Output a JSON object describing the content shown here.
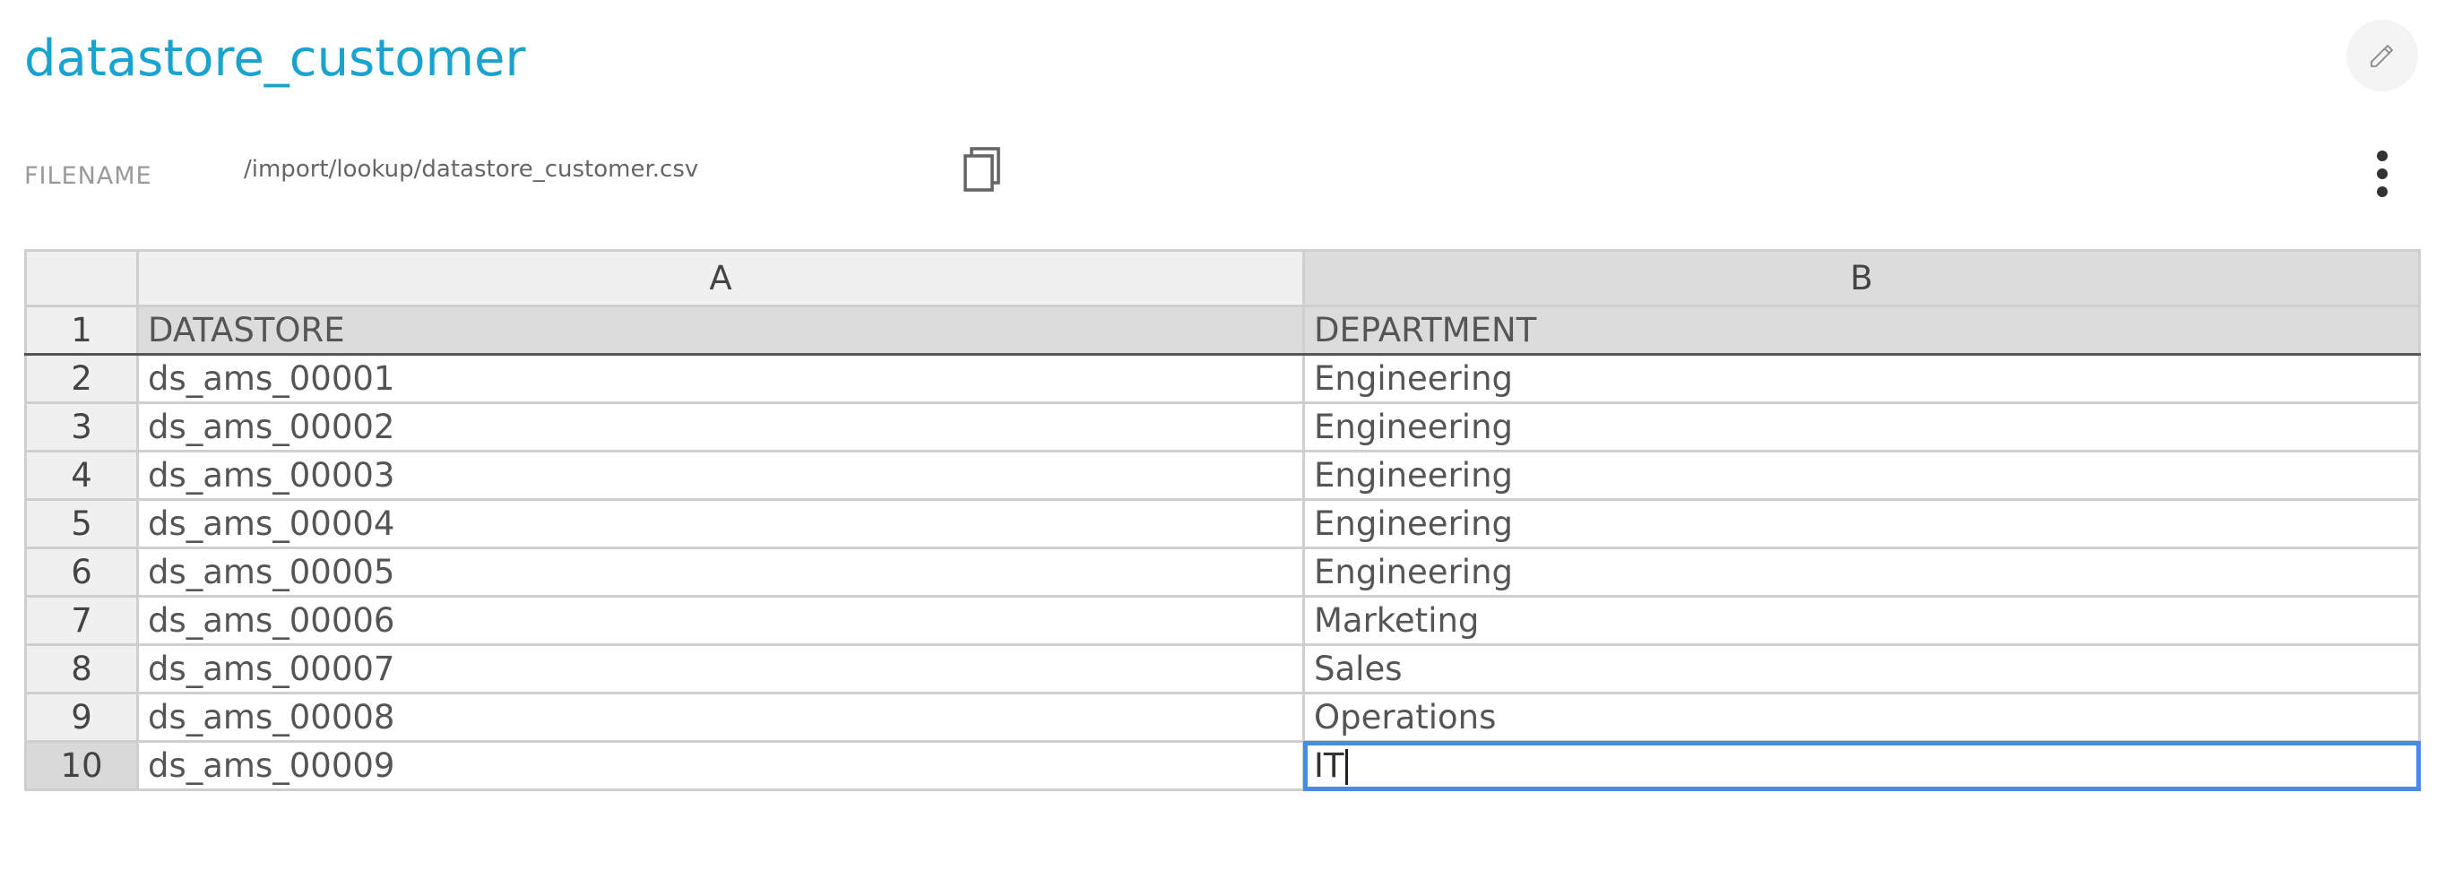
{
  "header": {
    "title": "datastore_customer",
    "edit_icon": "pencil-icon"
  },
  "file": {
    "label": "FILENAME",
    "path": "/import/lookup/datastore_customer.csv",
    "copy_icon": "copy-icon",
    "more_icon": "more-vert-icon"
  },
  "grid": {
    "columns": [
      "A",
      "B"
    ],
    "rows": [
      {
        "num": "1",
        "a": "DATASTORE",
        "b": "DEPARTMENT"
      },
      {
        "num": "2",
        "a": "ds_ams_00001",
        "b": "Engineering"
      },
      {
        "num": "3",
        "a": "ds_ams_00002",
        "b": "Engineering"
      },
      {
        "num": "4",
        "a": "ds_ams_00003",
        "b": "Engineering"
      },
      {
        "num": "5",
        "a": "ds_ams_00004",
        "b": "Engineering"
      },
      {
        "num": "6",
        "a": "ds_ams_00005",
        "b": "Engineering"
      },
      {
        "num": "7",
        "a": "ds_ams_00006",
        "b": "Marketing"
      },
      {
        "num": "8",
        "a": "ds_ams_00007",
        "b": "Sales"
      },
      {
        "num": "9",
        "a": "ds_ams_00008",
        "b": "Operations"
      },
      {
        "num": "10",
        "a": "ds_ams_00009",
        "b": "IT"
      }
    ],
    "selected_cell": "B10",
    "selection_color": "#4a8ae0"
  },
  "colors": {
    "title": "#1aa3cf",
    "header_bg": "#dcdcdc",
    "border": "#cfcfcf"
  }
}
